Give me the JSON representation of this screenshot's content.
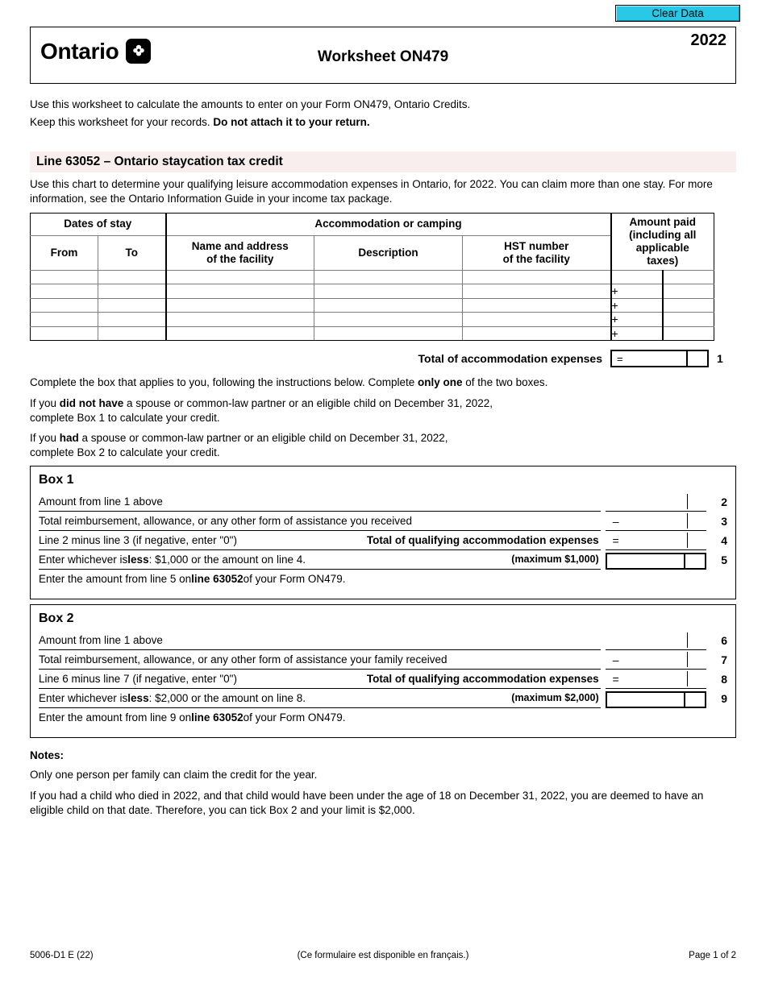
{
  "toolbar": {
    "clear_data_label": "Clear Data"
  },
  "header": {
    "province": "Ontario",
    "logo_icon": "ontario-trillium-icon",
    "title": "Worksheet ON479",
    "year": "2022"
  },
  "intro": {
    "line1": "Use this worksheet to calculate the amounts to enter on your Form ON479, Ontario Credits.",
    "line2_plain": "Keep this worksheet for your records. ",
    "line2_bold": "Do not attach it to your return."
  },
  "section": {
    "heading": "Line 63052 – Ontario staycation tax credit",
    "description": "Use this chart to determine your qualifying leisure accommodation expenses in Ontario, for 2022. You can claim more than one stay. For more information, see the Ontario Information Guide in your income tax package."
  },
  "expense_table": {
    "group_headers": {
      "dates": "Dates of stay",
      "accommodation": "Accommodation or camping",
      "amount_paid": "Amount paid (including all applicable taxes)",
      "amount_paid_lines": [
        "Amount paid",
        "(including all",
        "applicable",
        "taxes)"
      ]
    },
    "sub_headers": {
      "from": "From",
      "to": "To",
      "name_address_line1": "Name and address",
      "name_address_line2": "of the facility",
      "description": "Description",
      "hst_line1": "HST number",
      "hst_line2": "of the facility"
    },
    "rows": [
      {
        "from": "",
        "to": "",
        "name": "",
        "description": "",
        "hst": "",
        "op": "",
        "amount": "",
        "cents": ""
      },
      {
        "from": "",
        "to": "",
        "name": "",
        "description": "",
        "hst": "",
        "op": "+",
        "amount": "",
        "cents": ""
      },
      {
        "from": "",
        "to": "",
        "name": "",
        "description": "",
        "hst": "",
        "op": "+",
        "amount": "",
        "cents": ""
      },
      {
        "from": "",
        "to": "",
        "name": "",
        "description": "",
        "hst": "",
        "op": "+",
        "amount": "",
        "cents": ""
      },
      {
        "from": "",
        "to": "",
        "name": "",
        "description": "",
        "hst": "",
        "op": "+",
        "amount": "",
        "cents": ""
      }
    ],
    "total_label": "Total of accommodation expenses",
    "total_op": "=",
    "total_value": "",
    "total_cents": "",
    "total_line_number": "1"
  },
  "instructions": {
    "p1_a": "Complete the box that applies to you, following the instructions below. Complete ",
    "p1_bold": "only one",
    "p1_b": " of the two boxes.",
    "p2_a": "If you ",
    "p2_bold": "did not have",
    "p2_b": " a spouse or common-law partner or an eligible child on December 31, 2022,",
    "p2_c": "complete Box 1 to calculate your credit.",
    "p3_a": "If you ",
    "p3_bold": "had",
    "p3_b": " a spouse or common-law partner or an eligible child on December 31, 2022,",
    "p3_c": "complete Box 2 to calculate your credit."
  },
  "box1": {
    "title": "Box 1",
    "rows": [
      {
        "text": "Amount from line 1 above",
        "right_label": "",
        "op": "",
        "num": "2",
        "value": "",
        "cents": "",
        "boxed": false
      },
      {
        "text": "Total reimbursement, allowance, or any other form of assistance you received",
        "right_label": "",
        "op": "–",
        "num": "3",
        "value": "",
        "cents": "",
        "boxed": false
      },
      {
        "text": "Line 2 minus line 3 (if negative, enter \"0\")",
        "right_label": "Total of qualifying accommodation expenses",
        "op": "=",
        "num": "4",
        "value": "",
        "cents": "",
        "boxed": false
      },
      {
        "text": "Enter whichever is less: $1,000 or the amount on line 4.",
        "right_label": "(maximum $1,000)",
        "op": "",
        "num": "5",
        "value": "",
        "cents": "",
        "boxed": true
      }
    ],
    "row4_text_a": "Enter whichever is ",
    "row4_text_bold": "less",
    "row4_text_b": ": $1,000 or the amount on line 4.",
    "footer_a": "Enter the amount from line 5 on ",
    "footer_bold": "line 63052",
    "footer_b": " of your Form ON479."
  },
  "box2": {
    "title": "Box 2",
    "rows": [
      {
        "text": "Amount from line 1 above",
        "right_label": "",
        "op": "",
        "num": "6",
        "value": "",
        "cents": "",
        "boxed": false
      },
      {
        "text": "Total reimbursement, allowance, or any other form of assistance your family received",
        "right_label": "",
        "op": "–",
        "num": "7",
        "value": "",
        "cents": "",
        "boxed": false
      },
      {
        "text": "Line 6 minus line 7 (if negative, enter \"0\")",
        "right_label": "Total of qualifying accommodation expenses",
        "op": "=",
        "num": "8",
        "value": "",
        "cents": "",
        "boxed": false
      },
      {
        "text": "Enter whichever is less: $2,000 or the amount on line 8.",
        "right_label": "(maximum $2,000)",
        "op": "",
        "num": "9",
        "value": "",
        "cents": "",
        "boxed": true
      }
    ],
    "row4_text_a": "Enter whichever is ",
    "row4_text_bold": "less",
    "row4_text_b": ": $2,000 or the amount on line 8.",
    "footer_a": "Enter the amount from line 9 on ",
    "footer_bold": "line 63052",
    "footer_b": " of your Form ON479."
  },
  "notes": {
    "title": "Notes:",
    "note1": "Only one person per family can claim the credit for the year.",
    "note2": "If you had a child who died in 2022, and that child would have been under the age of 18 on December 31, 2022, you are deemed to have an eligible child on that date. Therefore, you can tick Box 2 and your limit is $2,000."
  },
  "footer": {
    "form_code": "5006-D1 E (22)",
    "french_note": "(Ce formulaire est disponible en français.)",
    "page": "Page 1 of 2"
  },
  "colors": {
    "clear_data_bg": "#28c8e6",
    "section_bar_bg": "#f8eeee",
    "text": "#000000",
    "table_grid": "#7d7d7d"
  }
}
